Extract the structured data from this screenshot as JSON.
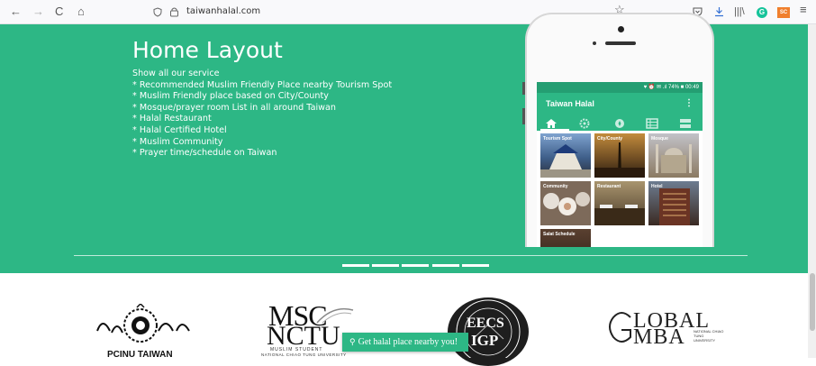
{
  "browser": {
    "url": "taiwanhalal.com",
    "back_icon": "←",
    "forward_icon": "→",
    "reload_icon": "C",
    "home_icon": "⌂",
    "shield_icon": "♡",
    "lock_icon": "🔒",
    "star_icon": "☆",
    "pocket_icon": "♡",
    "download_icon": "⤓",
    "library_icon": "|||\\",
    "grammarly_label": "G",
    "extension_label": "SC",
    "menu_icon": "≡"
  },
  "hero": {
    "title": "Home Layout",
    "intro": "Show all our service",
    "items": [
      "* Recommended Muslim Friendly Place nearby Tourism Spot",
      "* Muslim Friendly place based on City/County",
      "* Mosque/prayer room List in all around Taiwan",
      "* Halal Restaurant",
      "* Halal Certified Hotel",
      "* Muslim Community",
      "* Prayer time/schedule on Taiwan"
    ],
    "slide_count": 5,
    "background_color": "#2db785"
  },
  "phone": {
    "status": "♥ ⏰ ✉ .ıl 74% ■ 00:49",
    "app_title": "Taiwan Halal",
    "menu_icon": "⋮",
    "tabs": [
      "home-icon",
      "settings-icon",
      "compass-icon",
      "list-icon",
      "card-icon"
    ],
    "tiles": [
      {
        "label": "Tourism Spot",
        "color": "#3f5f8a"
      },
      {
        "label": "City/County",
        "color": "#6b4a22"
      },
      {
        "label": "Mosque",
        "color": "#7a6650"
      },
      {
        "label": "Community",
        "color": "#7d6a5a"
      },
      {
        "label": "Restaurant",
        "color": "#6a5a48"
      },
      {
        "label": "Hotel",
        "color": "#5a3a2a"
      },
      {
        "label": "Salat Schedule",
        "color": "#3a2a20"
      }
    ]
  },
  "sponsors": {
    "pcinu_caption": "PCINU TAIWAN",
    "msc_top": "MSC",
    "msc_bottom": "NCTU",
    "msc_sub1": "MUSLIM STUDENT",
    "msc_sub2": "NATIONAL CHIAO TUNG UNIVERSITY",
    "eecs_top": "EECS",
    "eecs_bottom": "IGP",
    "eecs_ring": "EECS International Graduate Program",
    "gmba_top": "LOBAL",
    "gmba_bottom": "MBA",
    "gmba_sub": "NATIONAL CHIAO TUNG UNIVERSITY"
  },
  "float_button": {
    "icon": "⚲",
    "label": "Get halal place nearby you!"
  }
}
